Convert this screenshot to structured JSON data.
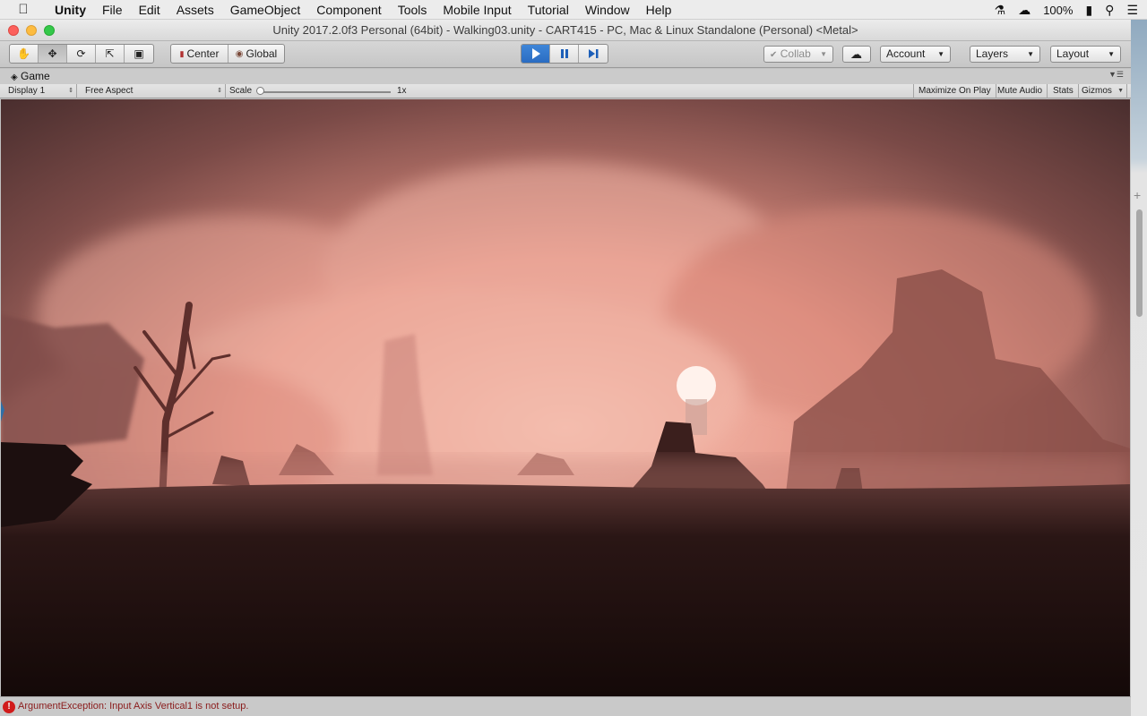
{
  "menubar": {
    "app": "Unity",
    "items": [
      "File",
      "Edit",
      "Assets",
      "GameObject",
      "Component",
      "Tools",
      "Mobile Input",
      "Tutorial",
      "Window",
      "Help"
    ],
    "battery": "100%"
  },
  "window": {
    "title": "Unity 2017.2.0f3 Personal (64bit) - Walking03.unity - CART415 - PC, Mac & Linux Standalone (Personal) <Metal>"
  },
  "toolbar": {
    "pivot_label": "Center",
    "space_label": "Global",
    "collab_label": "Collab",
    "account_label": "Account",
    "layers_label": "Layers",
    "layout_label": "Layout"
  },
  "game_tab": {
    "title": "Game",
    "display": "Display 1",
    "aspect": "Free Aspect",
    "scale_label": "Scale",
    "scale_value": "1x",
    "maximize_on_play": "Maximize On Play",
    "mute_audio": "Mute Audio",
    "stats": "Stats",
    "gizmos": "Gizmos"
  },
  "console": {
    "message": "ArgumentException: Input Axis Vertical1 is not setup."
  },
  "colors": {
    "play_active": "#2a6cc2",
    "error": "#d11b1b",
    "fog": "#e69b8c"
  }
}
